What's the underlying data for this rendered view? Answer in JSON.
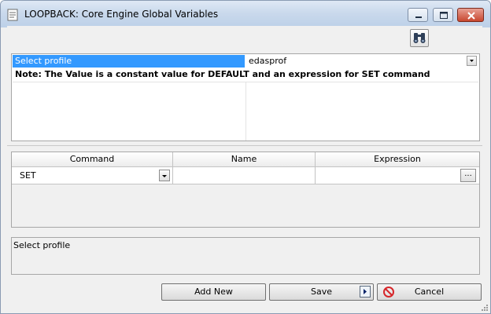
{
  "window": {
    "title": "LOOPBACK: Core Engine Global Variables",
    "controls": [
      "minimize",
      "maximize",
      "close"
    ]
  },
  "toolbar": {
    "find_icon": "binoculars-icon"
  },
  "profile": {
    "key_label": "Select profile",
    "value": "edasprof",
    "note": "Note: The Value is a constant value for DEFAULT and an expression for SET command"
  },
  "grid": {
    "columns": [
      "Command",
      "Name",
      "Expression"
    ],
    "rows": [
      {
        "command": "SET",
        "name": "",
        "expression": "",
        "ellipsis": "..."
      }
    ]
  },
  "description": {
    "text": "Select profile"
  },
  "buttons": {
    "add_new": "Add New",
    "save": "Save",
    "cancel": "Cancel"
  },
  "colors": {
    "selection": "#3399ff",
    "titlebar": "#cad9ec",
    "close_button": "#c8472f",
    "cancel_icon": "#d6262a"
  }
}
